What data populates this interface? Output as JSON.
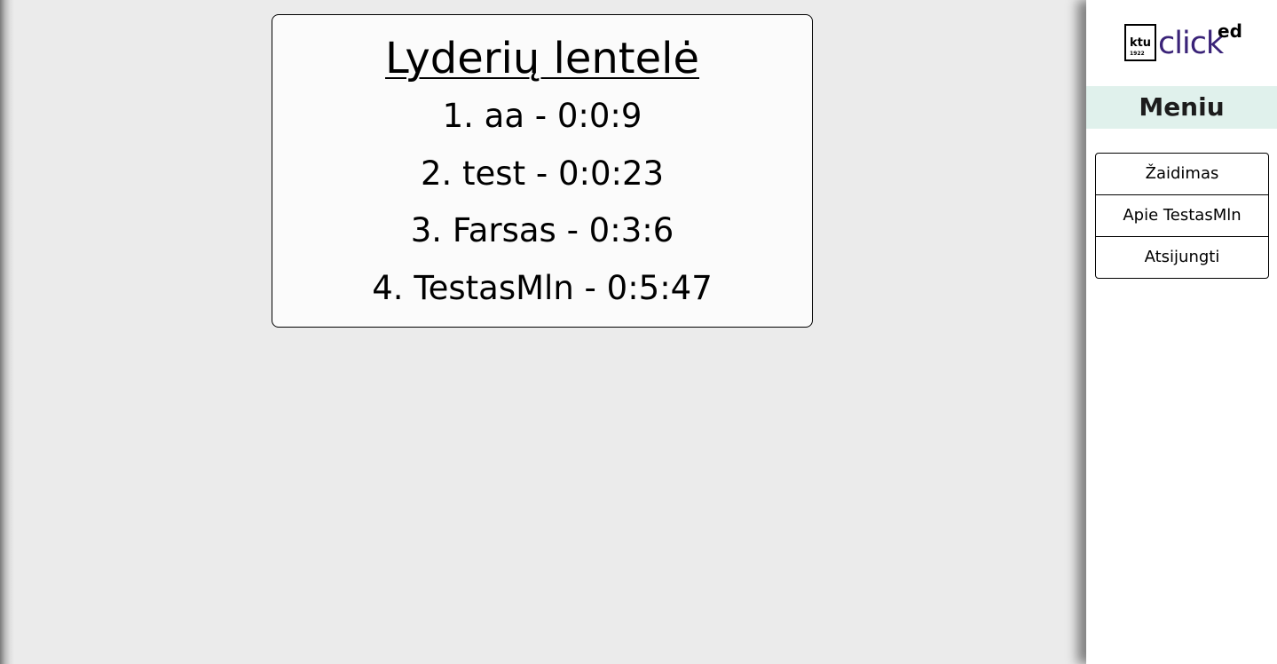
{
  "leaderboard": {
    "title": "Lyderių lentelė",
    "entries": [
      {
        "text": "1. aa - 0:0:9"
      },
      {
        "text": "2. test - 0:0:23"
      },
      {
        "text": "3. Farsas - 0:3:6"
      },
      {
        "text": "4. TestasMln - 0:5:47"
      }
    ]
  },
  "sidebar": {
    "logo": {
      "ktu": "ktu",
      "year": "1922",
      "click": "click",
      "ed": "ed"
    },
    "menu_title": "Meniu",
    "items": [
      {
        "label": "Žaidimas"
      },
      {
        "label": "Apie TestasMln"
      },
      {
        "label": "Atsijungti"
      }
    ]
  },
  "colors": {
    "background": "#ebebeb",
    "panel": "#fbfbfb",
    "menu_header_bg": "#e0f1ec",
    "logo_click": "#3a2378"
  }
}
